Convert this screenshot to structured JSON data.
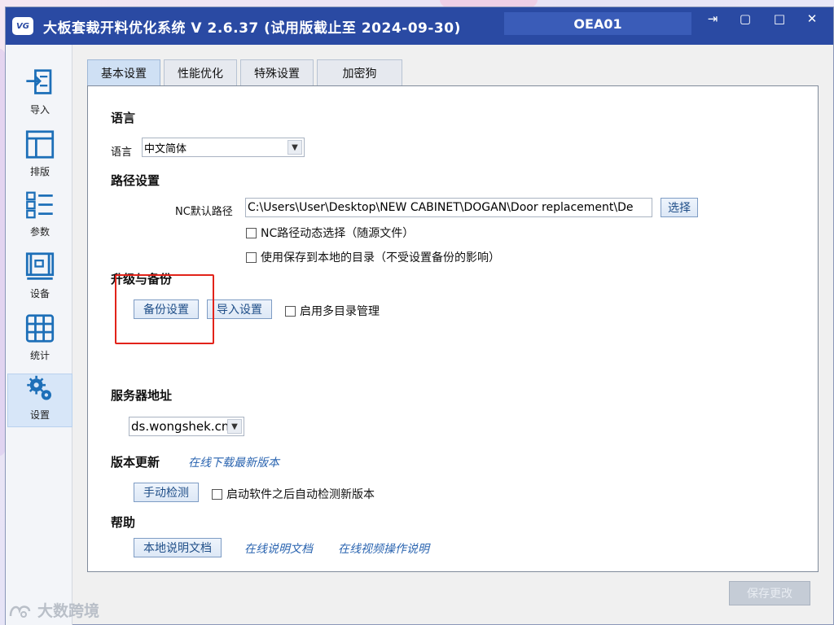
{
  "window": {
    "title": "大板套裁开料优化系统  V 2.6.37  (试用版截止至 2024-09-30)",
    "logo_text": "VG",
    "user_id": "OEA01",
    "exit_glyph": "⇥",
    "restore_glyph": "▢",
    "maximize_glyph": "□",
    "close_glyph": "✕"
  },
  "sidebar": {
    "items": [
      {
        "label": "导入",
        "icon": "import-icon"
      },
      {
        "label": "排版",
        "icon": "layout-icon"
      },
      {
        "label": "参数",
        "icon": "parameters-icon"
      },
      {
        "label": "设备",
        "icon": "device-icon"
      },
      {
        "label": "统计",
        "icon": "statistics-icon"
      },
      {
        "label": "设置",
        "icon": "settings-icon"
      }
    ],
    "active": "设置"
  },
  "tabs": [
    {
      "label": "基本设置",
      "active": true
    },
    {
      "label": "性能优化",
      "active": false
    },
    {
      "label": "特殊设置",
      "active": false
    },
    {
      "label": "加密狗",
      "active": false
    }
  ],
  "language": {
    "section": "语言",
    "label": "语言",
    "selected": "中文简体"
  },
  "paths": {
    "section": "路径设置",
    "nc_label": "NC默认路径",
    "nc_value": "C:\\Users\\User\\Desktop\\NEW CABINET\\DOGAN\\Door replacement\\De",
    "browse_label": "选择",
    "dynamic_label": "NC路径动态选择（随源文件）",
    "local_label": "使用保存到本地的目录（不受设置备份的影响）"
  },
  "backup": {
    "section": "升级与备份",
    "backup_button": "备份设置",
    "import_button": "导入设置",
    "multi_dir_label": "启用多目录管理"
  },
  "server": {
    "section": "服务器地址",
    "selected": "ds.wongshek.cn"
  },
  "update": {
    "section": "版本更新",
    "download_link": "在线下载最新版本",
    "check_button": "手动检测",
    "auto_check_label": "启动软件之后自动检测新版本"
  },
  "help": {
    "section": "帮助",
    "local_doc_button": "本地说明文档",
    "online_doc_link": "在线说明文档",
    "video_link": "在线视频操作说明"
  },
  "footer": {
    "save_button": "保存更改",
    "watermark": "大数跨境"
  },
  "colors": {
    "titlebar": "#2a4aa3",
    "accent_link": "#2a64b0",
    "highlight": "#e2231a"
  }
}
